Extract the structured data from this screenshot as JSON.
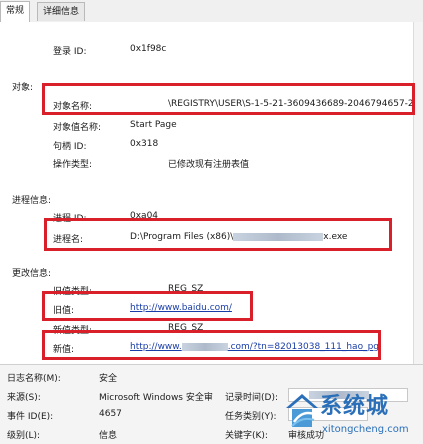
{
  "tabs": [
    {
      "label": "常规",
      "active": true
    },
    {
      "label": "详细信息",
      "active": false
    }
  ],
  "detail": {
    "logon_id": {
      "label": "登录 ID:",
      "value": "0x1f98c"
    },
    "object_section": "对象:",
    "object_name": {
      "label": "对象名称:",
      "value": "\\REGISTRY\\USER\\S-1-5-21-3609436689-2046794657-2"
    },
    "object_value_name": {
      "label": "对象值名称:",
      "value": "Start Page"
    },
    "handle_id": {
      "label": "句柄 ID:",
      "value": "0x318"
    },
    "operation_type": {
      "label": "操作类型:",
      "value": "已修改现有注册表值"
    },
    "process_section": "进程信息:",
    "process_id": {
      "label": "进程 ID:",
      "value": "0xa04"
    },
    "process_name": {
      "label": "进程名:",
      "value_prefix": "D:\\Program Files (x86)\\",
      "value_suffix": "x.exe"
    },
    "change_section": "更改信息:",
    "old_type": {
      "label": "旧值类型:",
      "value": "REG_SZ"
    },
    "old_value": {
      "label": "旧值:",
      "value": "http://www.baidu.com/"
    },
    "new_type": {
      "label": "新值类型:",
      "value": "REG_SZ"
    },
    "new_value": {
      "label": "新值:",
      "value_prefix": "http://www.",
      "value_suffix": ".com/?tn=82013038_111_hao_pg"
    }
  },
  "general": {
    "log_name": {
      "label": "日志名称(M):",
      "value": "安全"
    },
    "source": {
      "label": "来源(S):",
      "value": "Microsoft Windows 安全审"
    },
    "logged": {
      "label": "记录时间(D):"
    },
    "event_id": {
      "label": "事件 ID(E):",
      "value": "4657"
    },
    "task_category": {
      "label": "任务类别(Y):"
    },
    "level": {
      "label": "级别(L):",
      "value": "信息"
    },
    "keywords": {
      "label": "关键字(K):",
      "value": "审核成功"
    }
  },
  "watermark": {
    "name": "系统城",
    "url": "xitongcheng.com"
  },
  "colors": {
    "highlight": "#d9202a",
    "link": "#1a3ea8",
    "brand": "#2a6fb8"
  }
}
